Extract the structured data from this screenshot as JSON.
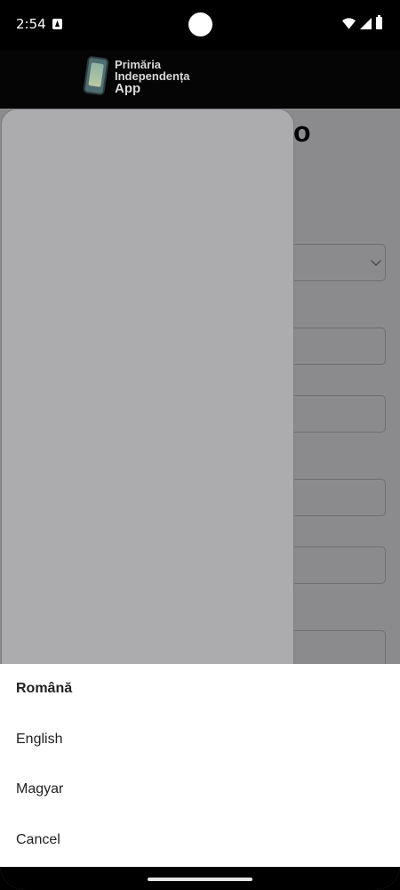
{
  "status_bar": {
    "time": "2:54",
    "icons": [
      "notification-a-icon",
      "wifi-icon",
      "signal-icon",
      "battery-icon"
    ]
  },
  "app": {
    "logo_line1": "Primăria",
    "logo_line2": "Independența",
    "logo_line3": "App"
  },
  "background": {
    "heading_fragment": "o"
  },
  "language_sheet": {
    "selected": "Română",
    "options": [
      "Română",
      "English",
      "Magyar"
    ],
    "cancel_label": "Cancel"
  },
  "colors": {
    "scrim": "#8b8a8d",
    "drawer": "#acabae",
    "sheet": "#ffffff"
  }
}
